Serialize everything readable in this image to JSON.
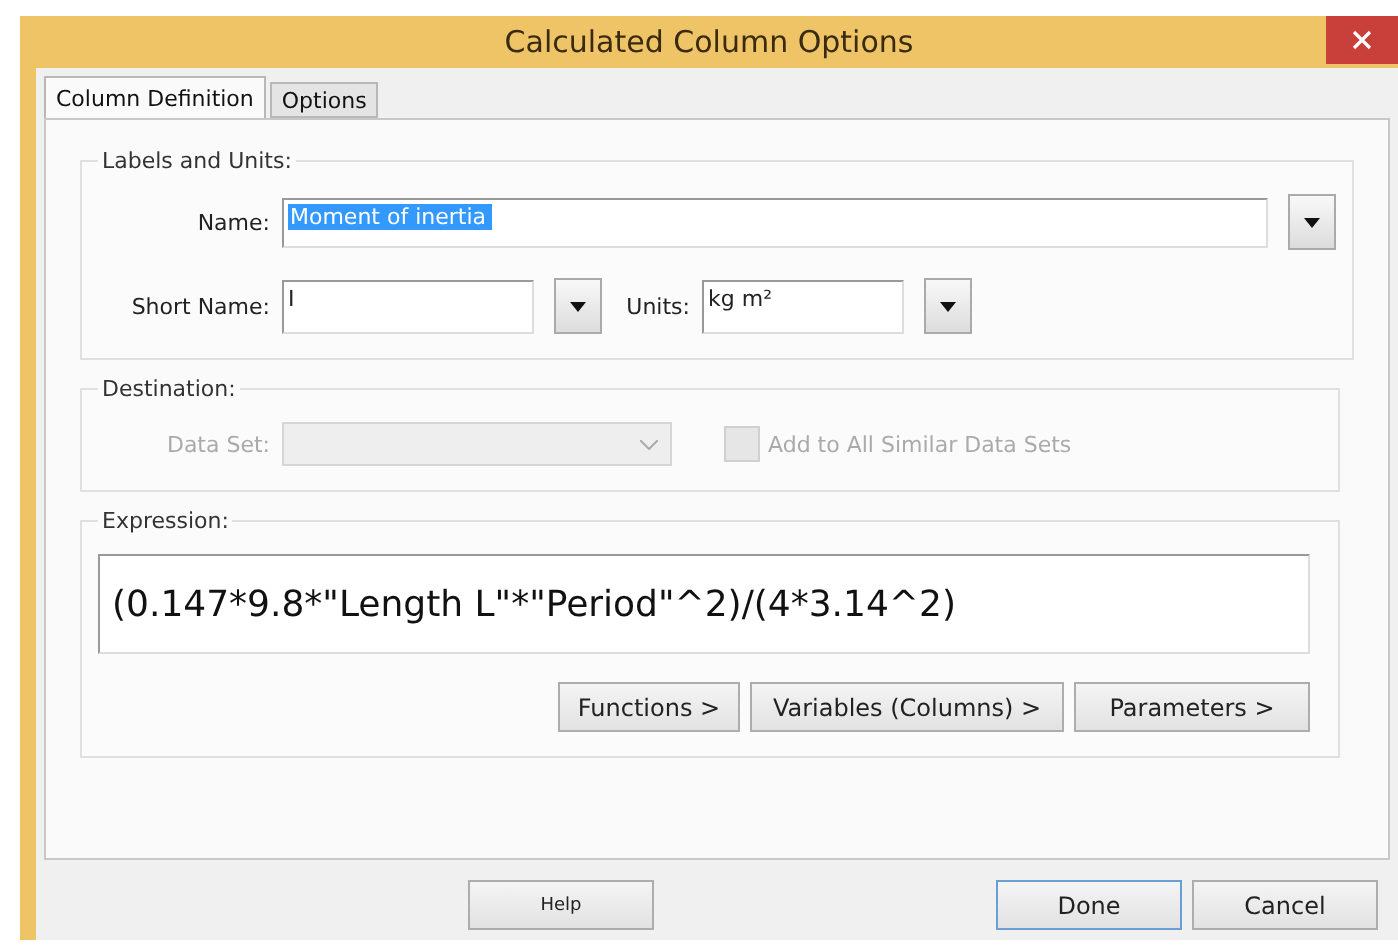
{
  "window": {
    "title": "Calculated Column Options"
  },
  "tabs": [
    {
      "label": "Column Definition",
      "selected": true
    },
    {
      "label": "Options",
      "selected": false
    }
  ],
  "labels_and_units": {
    "title": "Labels and Units:",
    "name": {
      "label": "Name:",
      "value": "Moment of inertia",
      "highlighted": true
    },
    "short_name": {
      "label": "Short Name:",
      "value": "I"
    },
    "units": {
      "label": "Units:",
      "value": "kg m²"
    }
  },
  "destination": {
    "title": "Destination:",
    "data_set": {
      "label": "Data Set:",
      "disabled": true
    },
    "add_to_all": {
      "label": "Add to All Similar Data Sets",
      "checked": false,
      "disabled": true
    }
  },
  "expression": {
    "title": "Expression:",
    "value": "(0.147*9.8*\"Length L\"*\"Period\"^2)/(4*3.14^2)",
    "buttons": [
      "Functions >",
      "Variables (Columns) >",
      "Parameters >"
    ]
  },
  "footer": {
    "help": "Help",
    "buttons": [
      {
        "label": "Done",
        "default": true
      },
      {
        "label": "Cancel",
        "default": false
      }
    ]
  }
}
